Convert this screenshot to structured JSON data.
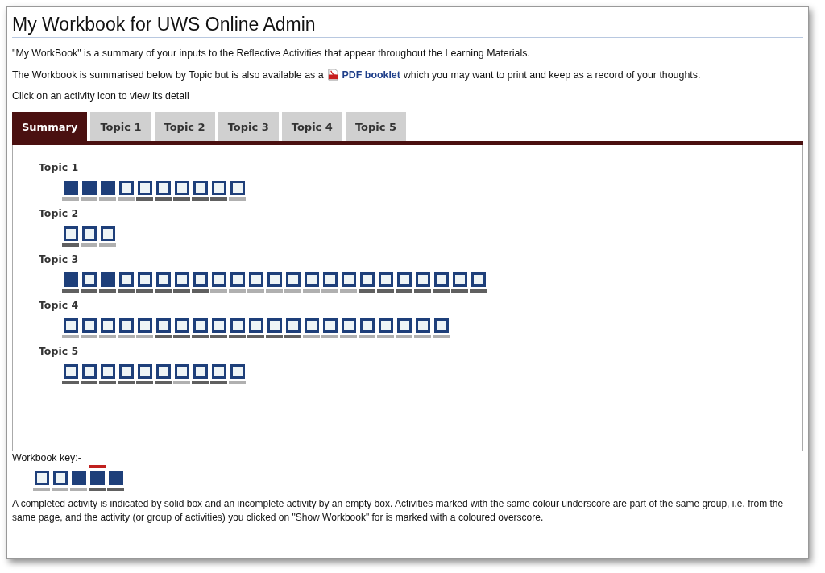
{
  "title": "My Workbook for UWS Online Admin",
  "intro": "\"My WorkBook\" is a summary of your inputs to the Reflective Activities that appear throughout the Learning Materials.",
  "pdf_line": {
    "before": "The Workbook is summarised below by Topic but is also available as a",
    "link": "PDF booklet",
    "after": "which you may want to print and keep as a record of your thoughts."
  },
  "instruction": "Click on an activity icon to view its detail",
  "tabs": [
    {
      "label": "Summary",
      "selected": true
    },
    {
      "label": "Topic 1",
      "selected": false
    },
    {
      "label": "Topic 2",
      "selected": false
    },
    {
      "label": "Topic 3",
      "selected": false
    },
    {
      "label": "Topic 4",
      "selected": false
    },
    {
      "label": "Topic 5",
      "selected": false
    }
  ],
  "topics": [
    {
      "name": "Topic 1",
      "activities": [
        {
          "completed": true,
          "color": "#b0b0b0"
        },
        {
          "completed": true,
          "color": "#b0b0b0"
        },
        {
          "completed": true,
          "color": "#b0b0b0"
        },
        {
          "completed": false,
          "color": "#b0b0b0"
        },
        {
          "completed": false,
          "color": "#606060"
        },
        {
          "completed": false,
          "color": "#606060"
        },
        {
          "completed": false,
          "color": "#606060"
        },
        {
          "completed": false,
          "color": "#606060"
        },
        {
          "completed": false,
          "color": "#606060"
        },
        {
          "completed": false,
          "color": "#b0b0b0"
        }
      ]
    },
    {
      "name": "Topic 2",
      "activities": [
        {
          "completed": false,
          "color": "#606060"
        },
        {
          "completed": false,
          "color": "#b0b0b0"
        },
        {
          "completed": false,
          "color": "#b0b0b0"
        }
      ]
    },
    {
      "name": "Topic 3",
      "activities": [
        {
          "completed": true,
          "color": "#606060"
        },
        {
          "completed": false,
          "color": "#606060"
        },
        {
          "completed": true,
          "color": "#606060"
        },
        {
          "completed": false,
          "color": "#606060"
        },
        {
          "completed": false,
          "color": "#606060"
        },
        {
          "completed": false,
          "color": "#606060"
        },
        {
          "completed": false,
          "color": "#606060"
        },
        {
          "completed": false,
          "color": "#606060"
        },
        {
          "completed": false,
          "color": "#b0b0b0"
        },
        {
          "completed": false,
          "color": "#b0b0b0"
        },
        {
          "completed": false,
          "color": "#b0b0b0"
        },
        {
          "completed": false,
          "color": "#b0b0b0"
        },
        {
          "completed": false,
          "color": "#b0b0b0"
        },
        {
          "completed": false,
          "color": "#b0b0b0"
        },
        {
          "completed": false,
          "color": "#b0b0b0"
        },
        {
          "completed": false,
          "color": "#b0b0b0"
        },
        {
          "completed": false,
          "color": "#606060"
        },
        {
          "completed": false,
          "color": "#606060"
        },
        {
          "completed": false,
          "color": "#606060"
        },
        {
          "completed": false,
          "color": "#606060"
        },
        {
          "completed": false,
          "color": "#606060"
        },
        {
          "completed": false,
          "color": "#606060"
        },
        {
          "completed": false,
          "color": "#606060"
        }
      ]
    },
    {
      "name": "Topic 4",
      "activities": [
        {
          "completed": false,
          "color": "#b0b0b0"
        },
        {
          "completed": false,
          "color": "#b0b0b0"
        },
        {
          "completed": false,
          "color": "#b0b0b0"
        },
        {
          "completed": false,
          "color": "#b0b0b0"
        },
        {
          "completed": false,
          "color": "#b0b0b0"
        },
        {
          "completed": false,
          "color": "#606060"
        },
        {
          "completed": false,
          "color": "#606060"
        },
        {
          "completed": false,
          "color": "#606060"
        },
        {
          "completed": false,
          "color": "#606060"
        },
        {
          "completed": false,
          "color": "#606060"
        },
        {
          "completed": false,
          "color": "#606060"
        },
        {
          "completed": false,
          "color": "#606060"
        },
        {
          "completed": false,
          "color": "#606060"
        },
        {
          "completed": false,
          "color": "#b0b0b0"
        },
        {
          "completed": false,
          "color": "#b0b0b0"
        },
        {
          "completed": false,
          "color": "#b0b0b0"
        },
        {
          "completed": false,
          "color": "#b0b0b0"
        },
        {
          "completed": false,
          "color": "#b0b0b0"
        },
        {
          "completed": false,
          "color": "#b0b0b0"
        },
        {
          "completed": false,
          "color": "#b0b0b0"
        },
        {
          "completed": false,
          "color": "#b0b0b0"
        }
      ]
    },
    {
      "name": "Topic 5",
      "activities": [
        {
          "completed": false,
          "color": "#606060"
        },
        {
          "completed": false,
          "color": "#606060"
        },
        {
          "completed": false,
          "color": "#606060"
        },
        {
          "completed": false,
          "color": "#606060"
        },
        {
          "completed": false,
          "color": "#606060"
        },
        {
          "completed": false,
          "color": "#606060"
        },
        {
          "completed": false,
          "color": "#b0b0b0"
        },
        {
          "completed": false,
          "color": "#606060"
        },
        {
          "completed": false,
          "color": "#606060"
        },
        {
          "completed": false,
          "color": "#b0b0b0"
        }
      ]
    }
  ],
  "key": {
    "label": "Workbook key:-",
    "activities": [
      {
        "completed": false,
        "color": "#b0b0b0",
        "highlighted": false
      },
      {
        "completed": false,
        "color": "#b0b0b0",
        "highlighted": false
      },
      {
        "completed": true,
        "color": "#b0b0b0",
        "highlighted": false
      },
      {
        "completed": true,
        "color": "#606060",
        "highlighted": true
      },
      {
        "completed": true,
        "color": "#606060",
        "highlighted": false
      }
    ],
    "explanation": "A completed activity is indicated by solid box and an incomplete activity by an empty box. Activities marked with the same colour underscore are part of the same group, i.e. from the same page, and the activity (or group of activities) you clicked on \"Show Workbook\" for is marked with a coloured overscore."
  }
}
